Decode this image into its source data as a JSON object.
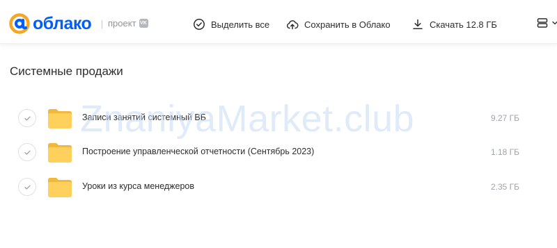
{
  "header": {
    "logo_text": "облако",
    "project_label": "проект",
    "vk_badge": "VK",
    "actions": {
      "select_all": "Выделить все",
      "save_to_cloud": "Сохранить в Облако",
      "download": "Скачать 12.8 ГБ"
    }
  },
  "main": {
    "title": "Системные продажи",
    "items": [
      {
        "name": "Записи занятий системный ВБ",
        "size": "9.27 ГБ"
      },
      {
        "name": "Построение управленческой отчетности (Сентябрь 2023)",
        "size": "1.18 ГБ"
      },
      {
        "name": "Уроки из курса менеджеров",
        "size": "2.35 ГБ"
      }
    ]
  },
  "watermark": "ZnaniyaMarket.club",
  "colors": {
    "brand_blue": "#005ff9",
    "brand_orange": "#f5a623",
    "folder_yellow": "#ffd15c"
  },
  "icons": {
    "select_all": "check-circle-icon",
    "save": "cloud-upload-icon",
    "download": "download-icon",
    "view": "list-view-icon"
  }
}
